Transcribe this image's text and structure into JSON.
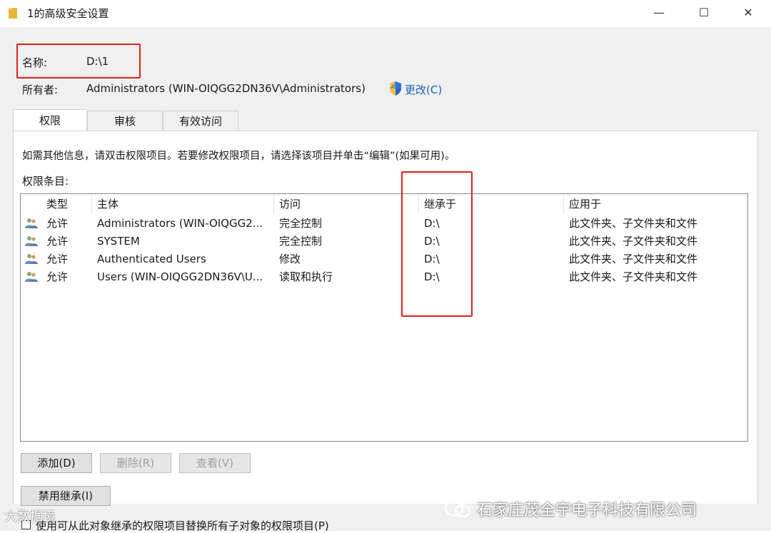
{
  "window": {
    "title": "1的高级安全设置",
    "minimize": "—",
    "maximize": "☐",
    "close": "✕"
  },
  "info": {
    "name_label": "名称:",
    "name_value": "D:\\1",
    "owner_label": "所有者:",
    "owner_value": "Administrators (WIN-OIQGG2DN36V\\Administrators)",
    "change_link": "更改(C)"
  },
  "tabs": [
    {
      "label": "权限",
      "active": true
    },
    {
      "label": "审核",
      "active": false
    },
    {
      "label": "有效访问",
      "active": false
    }
  ],
  "permissions": {
    "hint": "如需其他信息，请双击权限项目。若要修改权限项目，请选择该项目并单击“编辑”(如果可用)。",
    "entries_label": "权限条目:",
    "columns": [
      "类型",
      "主体",
      "访问",
      "继承于",
      "应用于"
    ],
    "rows": [
      {
        "type": "允许",
        "principal": "Administrators (WIN-OIQGG2...",
        "access": "完全控制",
        "inherited_from": "D:\\",
        "applies_to": "此文件夹、子文件夹和文件"
      },
      {
        "type": "允许",
        "principal": "SYSTEM",
        "access": "完全控制",
        "inherited_from": "D:\\",
        "applies_to": "此文件夹、子文件夹和文件"
      },
      {
        "type": "允许",
        "principal": "Authenticated Users",
        "access": "修改",
        "inherited_from": "D:\\",
        "applies_to": "此文件夹、子文件夹和文件"
      },
      {
        "type": "允许",
        "principal": "Users (WIN-OIQGG2DN36V\\U...",
        "access": "读取和执行",
        "inherited_from": "D:\\",
        "applies_to": "此文件夹、子文件夹和文件"
      }
    ]
  },
  "buttons": {
    "add": "添加(D)",
    "remove": "删除(R)",
    "view": "查看(V)",
    "disable_inheritance": "禁用继承(I)"
  },
  "checkbox": {
    "label": "使用可从此对象继承的权限项目替换所有子对象的权限项目(P)",
    "checked": false
  },
  "watermarks": {
    "right": "石家庄茂全宇电子科技有限公司",
    "left": "大数据境"
  },
  "colors": {
    "highlight_box": "#e02020",
    "link": "#1a64b4"
  }
}
